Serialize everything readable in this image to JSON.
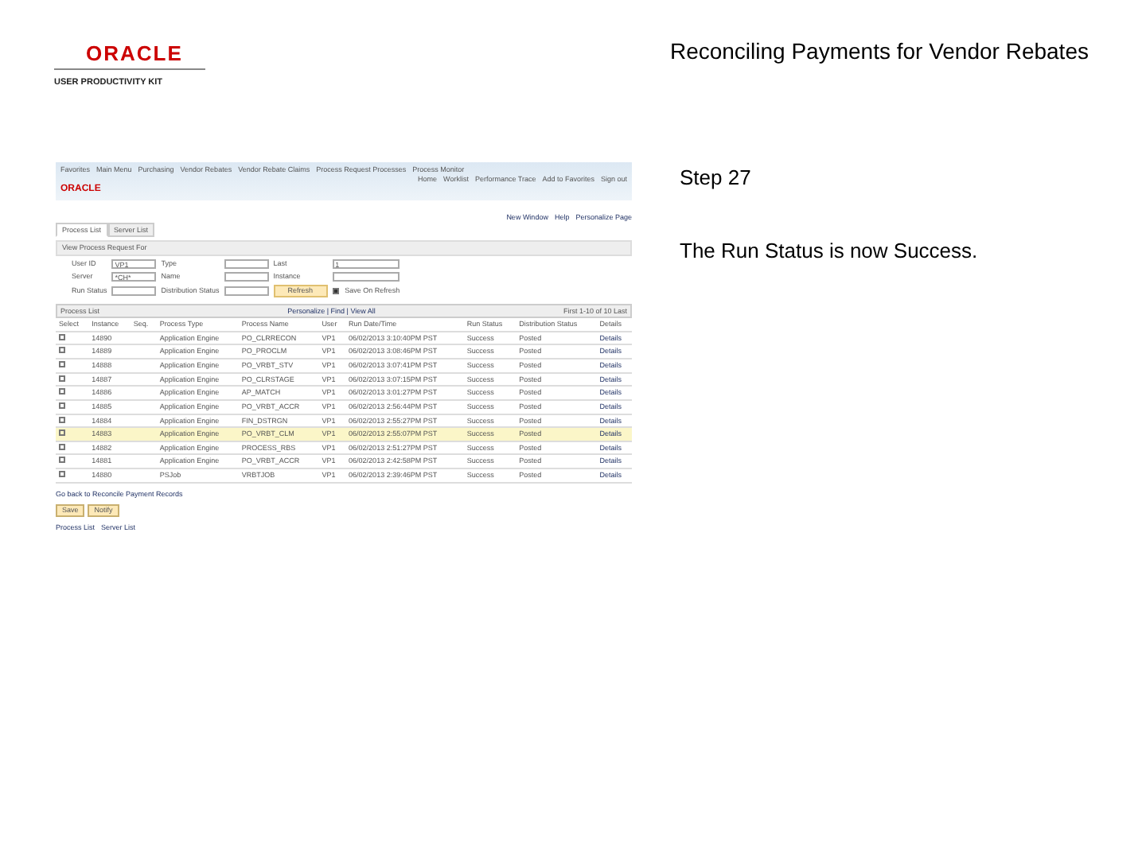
{
  "header": {
    "logo": "ORACLE",
    "logo_sub": "USER PRODUCTIVITY KIT",
    "title": "Reconciling Payments for Vendor Rebates"
  },
  "screenshot": {
    "breadcrumb": [
      "Favorites",
      "Main Menu",
      "Purchasing",
      "Vendor Rebates",
      "Vendor Rebate Claims",
      "Process Request Processes",
      "Process Monitor"
    ],
    "toplinks": [
      "Home",
      "Worklist",
      "Performance Trace",
      "Add to Favorites",
      "Sign out"
    ],
    "app_logo": "ORACLE",
    "pagelinks": [
      "New Window",
      "Help",
      "Personalize Page"
    ],
    "tabs": [
      {
        "label": "Process List",
        "selected": true
      },
      {
        "label": "Server List",
        "selected": false
      }
    ],
    "section": "View Process Request For",
    "filters": [
      {
        "label": "User ID",
        "value": "VP1"
      },
      {
        "label": "Type"
      },
      {
        "label": "Last",
        "value": "1"
      },
      {
        "label": "Server",
        "value": "*CH*"
      },
      {
        "label": "Name"
      },
      {
        "label": "Instance"
      },
      {
        "label": "Run Status"
      },
      {
        "label": "Distribution Status"
      }
    ],
    "refresh": "Refresh",
    "save_on_refresh": {
      "label": "Save On Refresh",
      "checked": true
    },
    "grid_title": "Process List",
    "grid_tools": "Personalize | Find | View All",
    "grid_nav": "First 1-10 of 10 Last",
    "select_header": "Select",
    "columns": [
      "Instance",
      "Seq.",
      "Process Type",
      "Process Name",
      "User",
      "Run Date/Time",
      "Run Status",
      "Distribution Status",
      "Details"
    ],
    "rows": [
      {
        "selected": false,
        "cells": [
          "14890",
          "",
          "Application Engine",
          "PO_CLRRECON",
          "VP1",
          "06/02/2013 3:10:40PM PST",
          "Success",
          "Posted",
          "Details"
        ]
      },
      {
        "selected": false,
        "cells": [
          "14889",
          "",
          "Application Engine",
          "PO_PROCLM",
          "VP1",
          "06/02/2013 3:08:46PM PST",
          "Success",
          "Posted",
          "Details"
        ]
      },
      {
        "selected": false,
        "cells": [
          "14888",
          "",
          "Application Engine",
          "PO_VRBT_STV",
          "VP1",
          "06/02/2013 3:07:41PM PST",
          "Success",
          "Posted",
          "Details"
        ]
      },
      {
        "selected": false,
        "cells": [
          "14887",
          "",
          "Application Engine",
          "PO_CLRSTAGE",
          "VP1",
          "06/02/2013 3:07:15PM PST",
          "Success",
          "Posted",
          "Details"
        ]
      },
      {
        "selected": false,
        "cells": [
          "14886",
          "",
          "Application Engine",
          "AP_MATCH",
          "VP1",
          "06/02/2013 3:01:27PM PST",
          "Success",
          "Posted",
          "Details"
        ]
      },
      {
        "selected": false,
        "cells": [
          "14885",
          "",
          "Application Engine",
          "PO_VRBT_ACCR",
          "VP1",
          "06/02/2013 2:56:44PM PST",
          "Success",
          "Posted",
          "Details"
        ]
      },
      {
        "selected": false,
        "cells": [
          "14884",
          "",
          "Application Engine",
          "FIN_DSTRGN",
          "VP1",
          "06/02/2013 2:55:27PM PST",
          "Success",
          "Posted",
          "Details"
        ]
      },
      {
        "selected": true,
        "cells": [
          "14883",
          "",
          "Application Engine",
          "PO_VRBT_CLM",
          "VP1",
          "06/02/2013 2:55:07PM PST",
          "Success",
          "Posted",
          "Details"
        ]
      },
      {
        "selected": false,
        "cells": [
          "14882",
          "",
          "Application Engine",
          "PROCESS_RBS",
          "VP1",
          "06/02/2013 2:51:27PM PST",
          "Success",
          "Posted",
          "Details"
        ]
      },
      {
        "selected": false,
        "cells": [
          "14881",
          "",
          "Application Engine",
          "PO_VRBT_ACCR",
          "VP1",
          "06/02/2013 2:42:58PM PST",
          "Success",
          "Posted",
          "Details"
        ]
      },
      {
        "selected": false,
        "cells": [
          "14880",
          "",
          "PSJob",
          "VRBTJOB",
          "VP1",
          "06/02/2013 2:39:46PM PST",
          "Success",
          "Posted",
          "Details"
        ]
      }
    ],
    "go_back": "Go back to Reconcile Payment Records",
    "buttons": [
      "Save",
      "Notify"
    ],
    "footer_links": [
      "Process List",
      "Server List"
    ]
  },
  "step": {
    "label": "Step 27",
    "text": "The Run Status is now Success."
  }
}
